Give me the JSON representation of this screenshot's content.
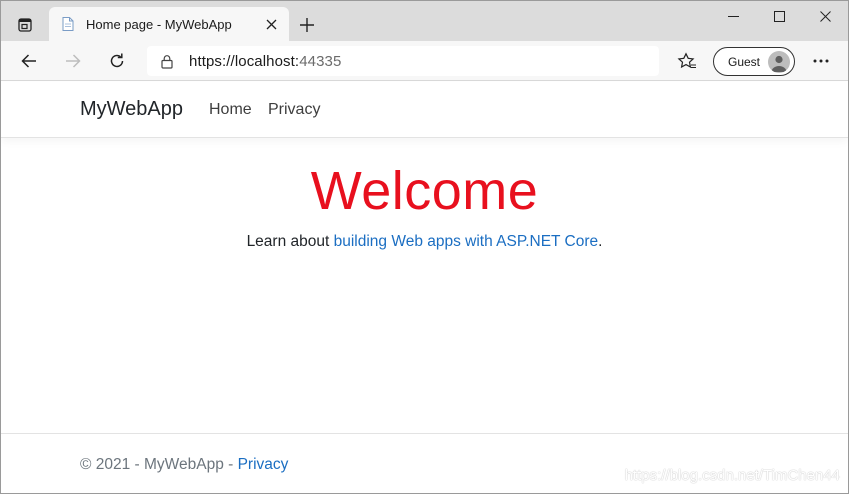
{
  "tab": {
    "title": "Home page - MyWebApp",
    "close_icon": "close-icon",
    "new_tab_icon": "plus-icon"
  },
  "window_controls": {
    "minimize": "minimize-icon",
    "maximize": "maximize-icon",
    "close": "close-icon"
  },
  "toolbar": {
    "url_host": "https://localhost:",
    "url_port": "44335",
    "guest_label": "Guest"
  },
  "site": {
    "brand": "MyWebApp",
    "nav": [
      {
        "label": "Home"
      },
      {
        "label": "Privacy"
      }
    ],
    "hero_title": "Welcome",
    "hero_prefix": "Learn about ",
    "hero_link": "building Web apps with ASP.NET Core",
    "hero_suffix": ".",
    "footer_prefix": "© 2021 - MyWebApp - ",
    "footer_link": "Privacy",
    "watermark": "https://blog.csdn.net/TimChen44"
  },
  "colors": {
    "accent_link": "#1b6ec2",
    "welcome_red": "#e8101e"
  }
}
